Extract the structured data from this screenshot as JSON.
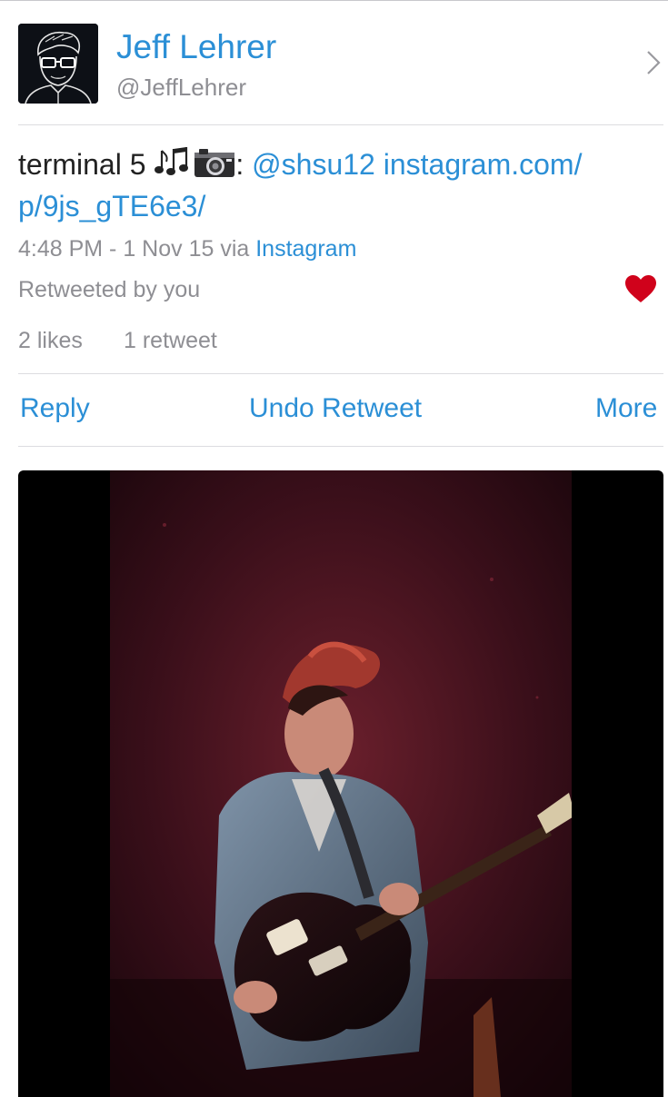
{
  "author": {
    "name": "Jeff Lehrer",
    "handle": "@JeffLehrer",
    "avatar_icon": "avatar-illustration",
    "chevron_icon": "chevron-right-icon"
  },
  "tweet": {
    "text_plain": "terminal 5 ",
    "emojis": [
      "musical-notes-icon",
      "camera-icon"
    ],
    "colon": ": ",
    "mention": "@shsu12",
    "link_line1": "instagram.com/",
    "link_line2": "p/9js_gTE6e3/"
  },
  "meta": {
    "time": "4:48 PM - 1 Nov 15 via ",
    "via": "Instagram"
  },
  "retweeted_label": "Retweeted by you",
  "liked": true,
  "stats": {
    "likes": "2 likes",
    "retweets": "1 retweet"
  },
  "actions": {
    "reply": "Reply",
    "undo_retweet": "Undo Retweet",
    "more": "More"
  },
  "media": {
    "type": "photo"
  },
  "colors": {
    "link": "#2b8fd6",
    "muted": "#8e8e93",
    "heart": "#d0021b",
    "divider": "#dcdce0"
  }
}
